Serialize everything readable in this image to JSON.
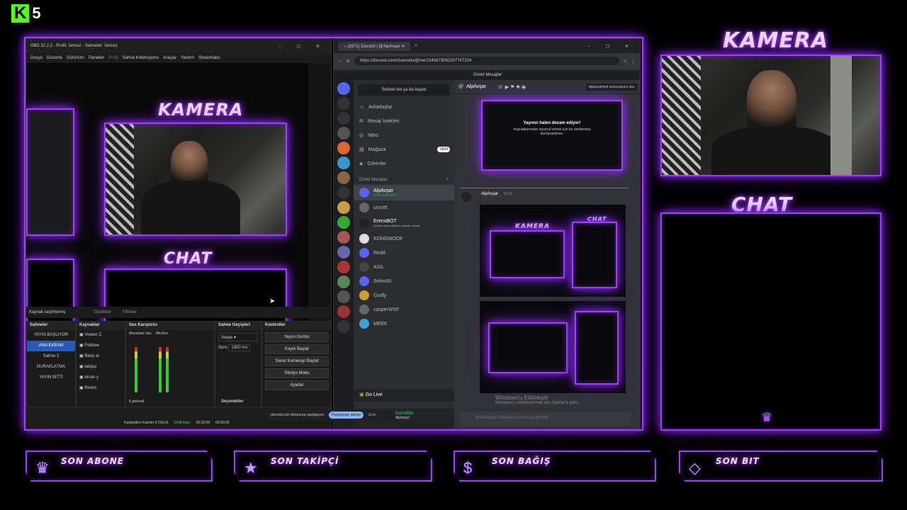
{
  "brand_badge": {
    "letter": "K",
    "num": "5"
  },
  "overlay": {
    "kamera": "KAMERA",
    "chat": "CHAT"
  },
  "bottom_boxes": [
    {
      "icon": "♛",
      "label": "SON ABONE"
    },
    {
      "icon": "★",
      "label": "SON TAKİPÇİ"
    },
    {
      "icon": "$",
      "label": "SON BAĞIŞ"
    },
    {
      "icon": "◇",
      "label": "SON BIT"
    }
  ],
  "obs": {
    "title": "OBS 32.2.2 - Profil: İsimsiz - Sahneler: İsimsiz",
    "menu": [
      "Dosya",
      "Düzenle",
      "Görünüm",
      "Paneller",
      "Profil",
      "Sahne Koleksiyonu",
      "Araçlar",
      "Yardım",
      "Streamlabs"
    ],
    "source_bar": {
      "label": "Kaynak seçilmemiş",
      "props": "Özellikler",
      "filters": "Filtreler"
    },
    "docks": {
      "scenes": "Sahneler",
      "sources": "Kaynaklar",
      "mixer": "Ses Karıştırıcı",
      "transitions": "Sahne Geçişleri",
      "controls": "Kontroller"
    },
    "scenes": [
      "YAYIN BAŞLIYOR",
      "ANA EKRAN",
      "Sahne 3",
      "DURAKLATMA",
      "YAYIN BİTTİ"
    ],
    "sources": [
      "Viewer C",
      "Followe",
      "Bierp al",
      "takipçi",
      "ekran y",
      "Resim"
    ],
    "mixer": {
      "ch1": "Masaüstü Ses",
      "ch2": "Mic/Aux",
      "hidden": "8 gizlendi"
    },
    "transition": {
      "type": "Swipe",
      "duration_label": "Süre",
      "duration": "1300 ms",
      "options": "Seçenekler"
    },
    "controls": [
      "Yayını Durdur",
      "Kaydı Başlat",
      "Sanal Kamerayı Başlat",
      "Stüdyo Modu",
      "Ayarlar"
    ],
    "status": {
      "frames": "Kaybedilen Kareler 0 (%0.0)",
      "bitrate": "5168 kbps",
      "time1": "02:32:09",
      "time2": "00:00:00"
    }
  },
  "browser": {
    "tab": "(2671) Discord | @AlpAvşar",
    "url": "https://discord.com/channels/@me/1540873092207747204"
  },
  "discord": {
    "top": "Direkt Mesajlar",
    "search": "Sohbet bul ya da başlat",
    "nav": [
      "Arkadaşlar",
      "Mesaj İstekleri",
      "Nitro",
      "Mağaza",
      "Görevler"
    ],
    "new_badge": "YENİ",
    "dm_header": "Direkt Mesajlar",
    "dms": [
      {
        "name": "AlpAvşar",
        "sub": "Sesli aramada"
      },
      {
        "name": "umuttt",
        "sub": ""
      },
      {
        "name": "ErensBOT",
        "sub": "Levels: erens.ai/level | adhelp | erbot"
      },
      {
        "name": "KONGMODE",
        "sub": ""
      },
      {
        "name": "Redd",
        "sub": ""
      },
      {
        "name": "ASIL",
        "sub": ""
      },
      {
        "name": "Selim00",
        "sub": ""
      },
      {
        "name": "Godly",
        "sub": ""
      },
      {
        "name": "casperWSF",
        "sub": ""
      },
      {
        "name": "MEE6",
        "sub": ""
      }
    ],
    "golive": "Go Live",
    "voice": {
      "title": "Ses Bağlantısı Kuruldu",
      "sub": "YAYINCI ODASI / Kick AlpAvşar"
    },
    "channel_name": "AlpAvşar",
    "channel_search": "alpavsarreal sunucusunu ara",
    "stream_msg": "Yayının halen devam ediyor!",
    "stream_sub": "Kaynaklarından tasarruf etmek için bu önizlemeyi durdurabilirsin.",
    "msg_author": "AlpAvşar",
    "msg_time": "00:56",
    "preview_labels": {
      "kamera": "KAMERA",
      "chat": "CHAT"
    },
    "input_placeholder": "@AlpAvşar kullanıcısına mesaj gönder",
    "windows_watermark": "Windows'u Etkinleştir",
    "windows_sub": "Windows'u etkinleştirmek için Ayarlar'a gidin."
  },
  "share_bar": {
    "text": "discord.com ekranınızı paylaşıyor.",
    "stop": "Paylaşmayı durdur",
    "hide": "Gizle"
  }
}
